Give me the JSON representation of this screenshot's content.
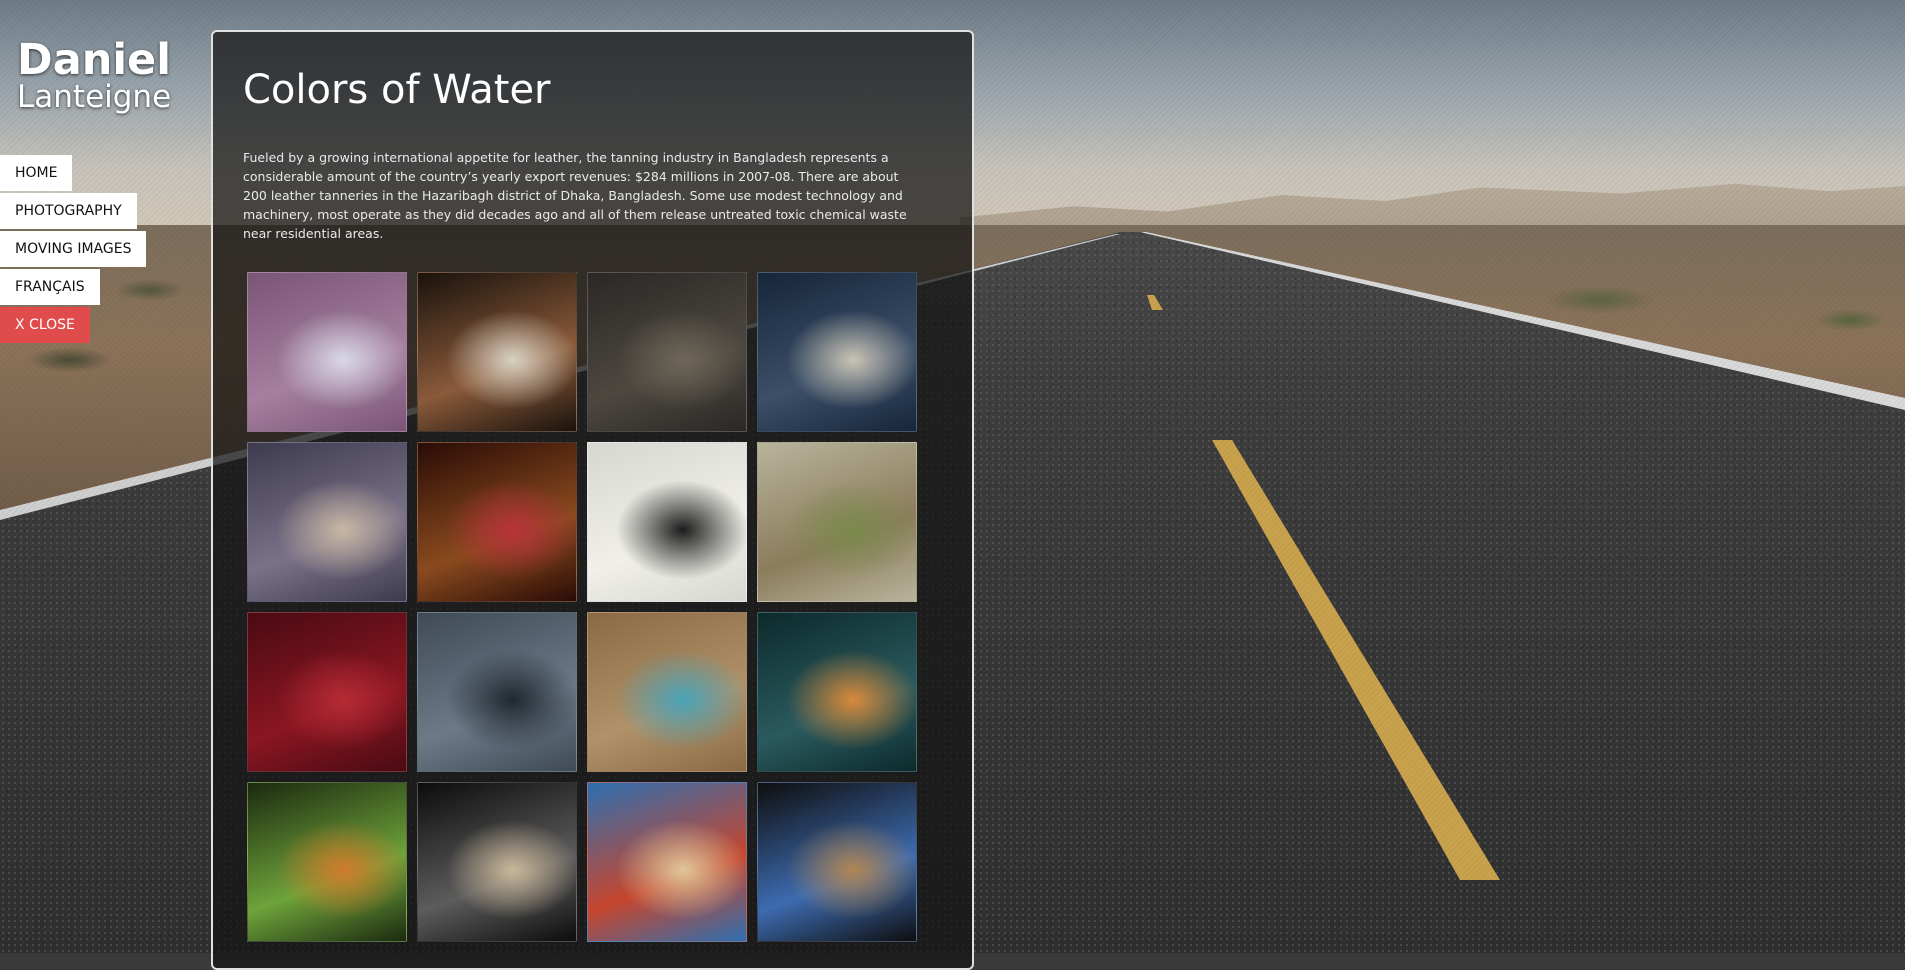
{
  "site": {
    "first_name": "Daniel",
    "last_name": "Lanteigne"
  },
  "nav": {
    "items": [
      {
        "label": "HOME",
        "name": "nav-home"
      },
      {
        "label": "PHOTOGRAPHY",
        "name": "nav-photography"
      },
      {
        "label": "MOVING IMAGES",
        "name": "nav-moving-images"
      },
      {
        "label": "FRANÇAIS",
        "name": "nav-francais"
      },
      {
        "label": "X CLOSE",
        "name": "nav-close"
      }
    ]
  },
  "gallery": {
    "title": "Colors of Water",
    "description": "Fueled by a growing international appetite for leather, the tanning industry in Bangladesh represents a considerable amount of the country’s yearly export revenues: $284 millions in 2007-08. There are about 200 leather tanneries in the Hazaribagh district of Dhaka, Bangladesh. Some use modest technology and machinery, most operate as they did decades ago and all of them release untreated toxic chemical waste near residential areas.",
    "thumbnails": [
      {
        "name": "thumb-purple-field-dog",
        "colors": [
          "#7a5577",
          "#a57fa0",
          "#d8d8e6"
        ]
      },
      {
        "name": "thumb-worker-arms",
        "colors": [
          "#1a120c",
          "#8a5a3a",
          "#d9d1c2"
        ]
      },
      {
        "name": "thumb-dark-sludge",
        "colors": [
          "#2a2826",
          "#4d4740",
          "#6e6658"
        ]
      },
      {
        "name": "thumb-man-portrait",
        "colors": [
          "#16263b",
          "#3b4f68",
          "#c9c3b5"
        ]
      },
      {
        "name": "thumb-blurred-hides",
        "colors": [
          "#3d3a4f",
          "#7a7288",
          "#c8b7a4"
        ]
      },
      {
        "name": "thumb-hand-embroidery",
        "colors": [
          "#2a0c06",
          "#8a4a1e",
          "#b8323a"
        ]
      },
      {
        "name": "thumb-white-cloth",
        "colors": [
          "#d7d7d2",
          "#f0efe8",
          "#1c1c1c"
        ]
      },
      {
        "name": "thumb-factory-river",
        "colors": [
          "#b8b49c",
          "#8b7c5c",
          "#7b8a4c"
        ]
      },
      {
        "name": "thumb-red-water",
        "colors": [
          "#4a0b12",
          "#8a1622",
          "#b42b35"
        ]
      },
      {
        "name": "thumb-boy-in-river",
        "colors": [
          "#3f4a55",
          "#6c7a88",
          "#20282f"
        ]
      },
      {
        "name": "thumb-child-slum",
        "colors": [
          "#8a6a44",
          "#b0926a",
          "#4aa3b8"
        ]
      },
      {
        "name": "thumb-water-splash",
        "colors": [
          "#0d2a2c",
          "#2a5a5e",
          "#d88a3a"
        ]
      },
      {
        "name": "thumb-vegetable-boats",
        "colors": [
          "#1b2a10",
          "#6ea33a",
          "#d07a2a"
        ]
      },
      {
        "name": "thumb-cargo-boat",
        "colors": [
          "#0c0c0c",
          "#5c5c5c",
          "#c9b79a"
        ]
      },
      {
        "name": "thumb-blue-boat",
        "colors": [
          "#2d6fb0",
          "#c6462e",
          "#e0c79a"
        ]
      },
      {
        "name": "thumb-sleeping-man",
        "colors": [
          "#0e0e0e",
          "#3d6bb0",
          "#b08654"
        ]
      }
    ]
  }
}
